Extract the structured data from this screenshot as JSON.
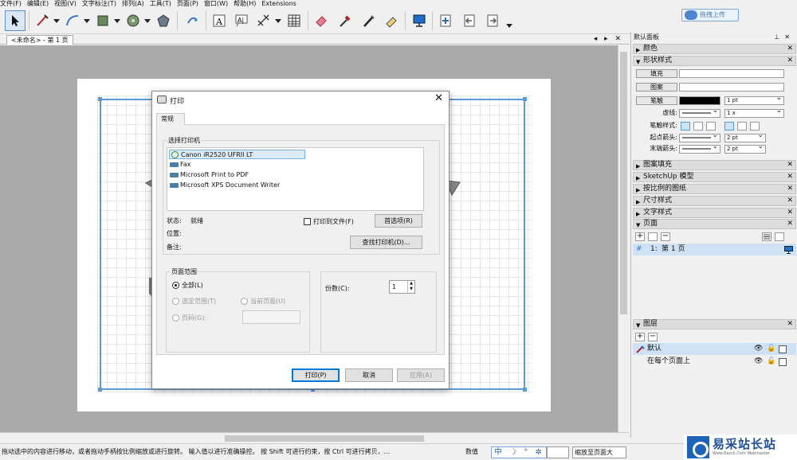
{
  "menubar": {
    "items": [
      "文件(F)",
      "编辑(E)",
      "视图(V)",
      "文字标注(T)",
      "排列(A)",
      "工具(T)",
      "页面(P)",
      "窗口(W)",
      "帮助(H)",
      "Extensions"
    ]
  },
  "toolbar": {
    "upload_label": "拖拽上传",
    "icons": [
      "select-arrow-icon",
      "pencil-line-icon",
      "arc-icon",
      "shape-icon",
      "circle-icon",
      "polygon-icon",
      "rotate-icon",
      "text-icon",
      "label-icon",
      "dimension-icon",
      "table-icon",
      "eraser-icon",
      "eyedropper-icon",
      "pen-icon",
      "highlighter-icon",
      "monitor-icon",
      "add-page-icon",
      "previous-page-icon",
      "next-page-icon"
    ]
  },
  "document": {
    "tab_label": "<未命名> - 第 1 页",
    "tab_nav": "◂ ▸ ✕"
  },
  "print_dialog": {
    "title": "打印",
    "tab": "常规",
    "select_printer_label": "选择打印机",
    "printers": [
      "Canon iR2520 UFRII LT",
      "Fax",
      "Microsoft Print to PDF",
      "Microsoft XPS Document Writer"
    ],
    "status_label": "状态:",
    "status_value": "就绪",
    "location_label": "位置:",
    "comment_label": "备注:",
    "print_to_file_label": "打印到文件(F)",
    "preferences_button": "首选项(R)",
    "find_printer_button": "查找打印机(D)...",
    "page_range_label": "页面范围",
    "range_all": "全部(L)",
    "range_selection": "选定范围(T)",
    "range_current": "当前页面(U)",
    "range_pages": "页码(G):",
    "copies_label": "份数(C):",
    "copies_value": "1",
    "print_button": "打印(P)",
    "cancel_button": "取消",
    "apply_button": "应用(A)"
  },
  "panel": {
    "title": "默认面板",
    "sections": {
      "colors": "颜色",
      "shape_style": "形状样式",
      "pattern_fill": "图案填充",
      "sketchup_model": "SketchUp 模型",
      "scaled_drawing": "按比例的图纸",
      "dimension_style": "尺寸样式",
      "text_style": "文字样式",
      "pages": "页面",
      "layers": "图层"
    },
    "shape": {
      "fill_label": "填充",
      "pattern_label": "图案",
      "stroke_label": "笔触",
      "stroke_width": "1 pt",
      "dash_label": "虚线:",
      "dash_scale": "1 x",
      "cap_label": "笔触样式:",
      "start_arrow_label": "起点箭头:",
      "end_arrow_label": "末端箭头:",
      "start_arrow_size": "2 pt",
      "end_arrow_size": "2 pt"
    },
    "pages": {
      "items": [
        {
          "number": "1:",
          "name": "第 1 页"
        }
      ],
      "hash": "#"
    },
    "layers": {
      "items": [
        "默认",
        "在每个页面上"
      ]
    }
  },
  "statusbar": {
    "text": "拖动选中的内容进行移动，或者拖动手柄按比例缩放或进行旋转。 输入值以进行准确操控。 按 Shift 可进行约束，按 Ctrl 可进行拷贝，...",
    "measure_label": "数值",
    "ime": "中 ☽ ° ✲",
    "zoom_value": "缩放至页面大"
  },
  "watermark": {
    "title": "易采站长站",
    "subtitle": "Www.Easck.Com Webmaster"
  },
  "colors": {
    "accent": "#5b9bd5",
    "canvas_bg": "#aaaaaa",
    "selected_row": "#cfe2f5"
  }
}
